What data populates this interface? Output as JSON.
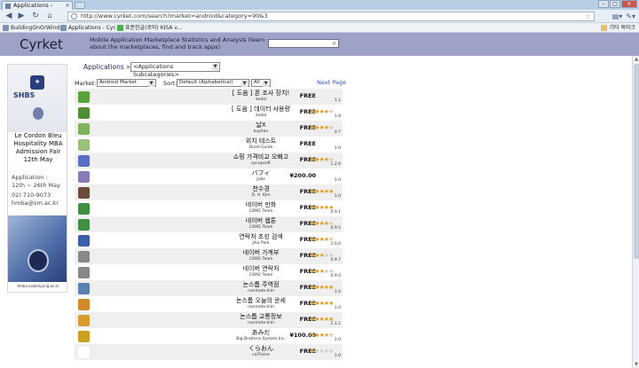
{
  "browser": {
    "active_tab_title": "Applications - Cyrket",
    "url": "http://www.cyrket.com/search?market=android&category=90&3",
    "bookmarks": [
      "BuildingOnOrWind...",
      "Applications - Cyr...",
      "표준한글(로마) KISA v..."
    ],
    "bookmarks_right": "기타 북마크",
    "icons": [
      "back-icon",
      "forward-icon",
      "reload-icon",
      "home-icon",
      "star-icon",
      "page-menu-icon",
      "wrench-icon"
    ]
  },
  "site": {
    "logo": "Cyrket",
    "tagline": "Mobile Application Marketplace Statistics and Analysis (learn about the marketplaces, find and track apps)",
    "search_placeholder": ""
  },
  "ad": {
    "brand": "SHBS",
    "line1": "Le Cordon Bleu",
    "line2": "Hospitality MBA",
    "line3": "Admission Fair",
    "line4": "12th May",
    "application_label": "Application :",
    "application_dates": "12th ~ 26th May",
    "phone": "02) 710-9073",
    "email": "hmba@sm.ac.kr",
    "footer": "hmba.sookmyung.ac.kr"
  },
  "main": {
    "breadcrumb": "Applications »",
    "subcategory_select": "<Applications Subcategories>",
    "market_label": "Market:",
    "market_value": "Android Market",
    "sort_label": "Sort:",
    "sort_value": "Default (Alphabetical)",
    "filter_value": "All",
    "next_page": "Next Page"
  },
  "apps": [
    {
      "name": "[ 도움 ] 폰 조사 장치!",
      "dev": "dodol",
      "price": "FREE",
      "stars": 0,
      "rating": "1.1",
      "icon_color": "#5aa33a"
    },
    {
      "name": "[ 도움 ] 데이터 사용량",
      "dev": "dodol",
      "price": "FREE",
      "stars": 4,
      "rating": "1.8",
      "icon_color": "#4f8e34"
    },
    {
      "name": "날X",
      "dev": "kuyhan",
      "price": "FREE",
      "stars": 3.5,
      "rating": "0.7",
      "icon_color": "#7db35a"
    },
    {
      "name": "위치 테스트",
      "dev": "Droid Guide",
      "price": "FREE",
      "stars": 0,
      "rating": "1.0",
      "icon_color": "#9ac07a"
    },
    {
      "name": "쇼핑 가격비교 오빠고",
      "dev": "synapsoft",
      "price": "FREE",
      "stars": 3.5,
      "rating": "1.2.6",
      "icon_color": "#5a6fc4"
    },
    {
      "name": "バフィ",
      "dev": "Jubs",
      "price": "¥200.00",
      "stars": 0,
      "rating": "1.0",
      "icon_color": "#8b7ab8"
    },
    {
      "name": "천수경",
      "dev": "D. H. Kim",
      "price": "FREE",
      "stars": 4.5,
      "rating": "1.0",
      "icon_color": "#6b4c3a"
    },
    {
      "name": "네이버 만화",
      "dev": "COM2 Team",
      "price": "FREE",
      "stars": 4.5,
      "rating": "0.9.1",
      "icon_color": "#3f8f45"
    },
    {
      "name": "네이버 웹툰",
      "dev": "COM2 Team",
      "price": "FREE",
      "stars": 3.5,
      "rating": "0.9.5",
      "icon_color": "#3f8f45"
    },
    {
      "name": "연락처 초성 검색",
      "dev": "Jiho Park",
      "price": "FREE",
      "stars": 4,
      "rating": "1.0.0",
      "icon_color": "#3a5fa8"
    },
    {
      "name": "네이버 가계부",
      "dev": "COM2 Team",
      "price": "FREE",
      "stars": 3,
      "rating": "0.9.7",
      "icon_color": "#888888"
    },
    {
      "name": "네이버 연락처",
      "dev": "COM2 Team",
      "price": "FREE",
      "stars": 3,
      "rating": "0.9.0",
      "icon_color": "#888888"
    },
    {
      "name": "논스톱 주역점",
      "dev": "nonmate-kim",
      "price": "FREE",
      "stars": 4.5,
      "rating": "1.0",
      "icon_color": "#5b7fae"
    },
    {
      "name": "논스톱 오늘의 운세",
      "dev": "nonmate-kim",
      "price": "FREE",
      "stars": 4.5,
      "rating": "1.0",
      "icon_color": "#d08a2a"
    },
    {
      "name": "논스톱 교통정보",
      "dev": "nonmate-kim",
      "price": "FREE",
      "stars": 5,
      "rating": "1.1.1",
      "icon_color": "#d89b2e"
    },
    {
      "name": "あみだ",
      "dev": "Big Brothers System,Inc.",
      "price": "¥100.00",
      "stars": 4,
      "rating": "1.0",
      "icon_color": "#c9a020"
    },
    {
      "name": "くらおん",
      "dev": "caFFeine",
      "price": "FREE",
      "stars": 1,
      "rating": "1.0",
      "icon_color": "#ffffff"
    }
  ]
}
